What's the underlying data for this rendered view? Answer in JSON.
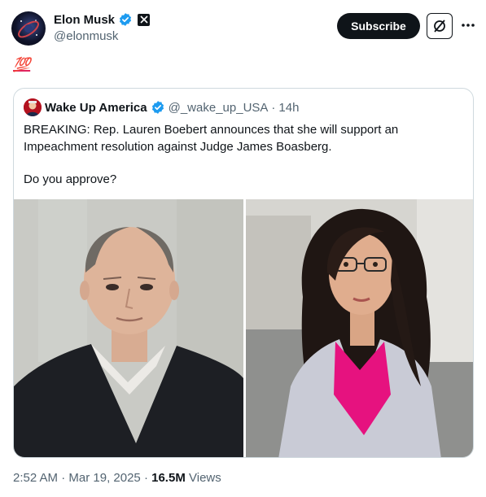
{
  "author": {
    "name": "Elon Musk",
    "handle": "@elonmusk",
    "avatar_icon": "galaxy-avatar-icon",
    "verified_icon": "verified-badge-icon",
    "affiliate_icon": "x-logo-icon"
  },
  "actions": {
    "subscribe_label": "Subscribe",
    "grok_icon": "grok-icon",
    "more_icon": "more-icon"
  },
  "tweet": {
    "text": "💯"
  },
  "quote": {
    "name": "Wake Up America",
    "handle": "@_wake_up_USA",
    "separator": "·",
    "time": "14h",
    "text_lines": [
      "BREAKING: Rep. Lauren Boebert announces that she will support an",
      "Impeachment resolution against Judge James Boasberg.",
      "Do you approve?"
    ],
    "media": [
      "judge-photo",
      "boebert-photo"
    ]
  },
  "footer": {
    "time": "2:52 AM",
    "separator": "·",
    "date": "Mar 19, 2025",
    "views_count": "16.5M",
    "views_label": "Views"
  },
  "colors": {
    "verified_blue": "#1d9bf0",
    "text": "#0f1419",
    "secondary": "#536471",
    "border": "#cfd9de"
  }
}
